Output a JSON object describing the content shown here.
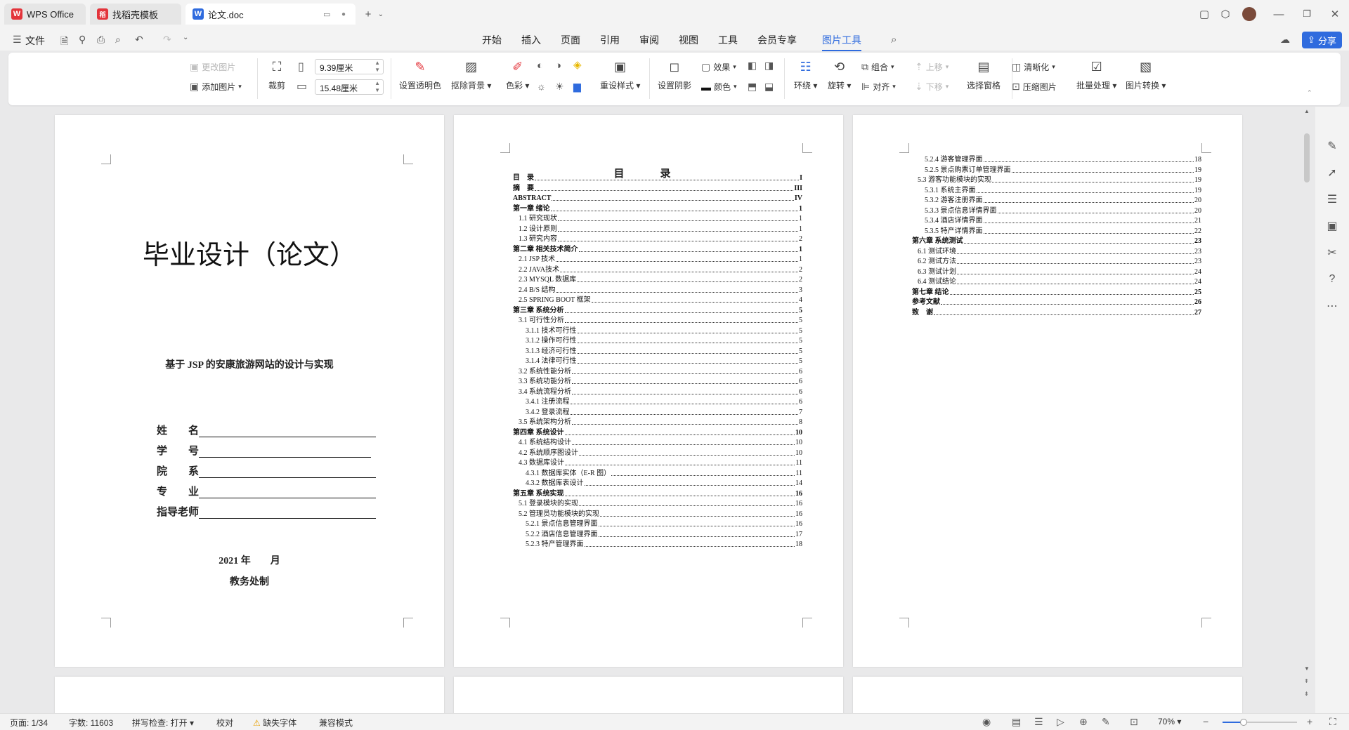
{
  "tabs": [
    {
      "label": "WPS Office",
      "logo": "W",
      "logo_color": "#e3343b"
    },
    {
      "label": "找稻壳模板",
      "logo": "稻",
      "logo_color": "#e3343b"
    },
    {
      "label": "论文.doc",
      "logo": "W",
      "logo_color": "#2f6bde"
    }
  ],
  "menu": {
    "file": "文件",
    "items": [
      "开始",
      "插入",
      "页面",
      "引用",
      "审阅",
      "视图",
      "工具",
      "会员专享",
      "图片工具"
    ],
    "active": "图片工具",
    "share": "分享"
  },
  "ribbon": {
    "change_image": "更改图片",
    "add_image": "添加图片",
    "crop": "裁剪",
    "width_value": "9.39厘米",
    "height_value": "15.48厘米",
    "set_transparent": "设置透明色",
    "remove_bg": "抠除背景",
    "color_shade": "色彩",
    "reset_style": "重设样式",
    "set_shadow": "设置阴影",
    "effect": "效果",
    "color": "颜色",
    "wrap": "环绕",
    "rotate": "旋转",
    "group": "组合",
    "align": "对齐",
    "move_up": "上移",
    "move_down": "下移",
    "selection_pane": "选择窗格",
    "sharpen": "清晰化",
    "compress": "压缩图片",
    "batch": "批量处理",
    "convert": "图片转换"
  },
  "page1": {
    "title": "毕业设计（论文）",
    "subtitle": "基于 JSP 的安康旅游网站的设计与实现",
    "fields": [
      "姓　　名",
      "学　　号",
      "院　　系",
      "专　　业",
      "指导老师"
    ],
    "date": "2021 年　　月",
    "office": "教务处制"
  },
  "toc_title": "目　录",
  "toc_page2": [
    {
      "t": "目　录",
      "n": "I",
      "lvl": 0,
      "b": true
    },
    {
      "t": "摘　要",
      "n": "III",
      "lvl": 0,
      "b": true
    },
    {
      "t": "ABSTRACT",
      "n": "IV",
      "lvl": 0,
      "b": true
    },
    {
      "t": "第一章  绪论",
      "n": "1",
      "lvl": 0,
      "b": true
    },
    {
      "t": "1.1 研究现状",
      "n": "1",
      "lvl": 1
    },
    {
      "t": "1.2 设计原则",
      "n": "1",
      "lvl": 1
    },
    {
      "t": "1.3 研究内容",
      "n": "2",
      "lvl": 1
    },
    {
      "t": "第二章  相关技术简介",
      "n": "1",
      "lvl": 0,
      "b": true
    },
    {
      "t": "2.1 JSP 技术",
      "n": "1",
      "lvl": 1
    },
    {
      "t": "2.2 JAVA技术",
      "n": "2",
      "lvl": 1
    },
    {
      "t": "2.3 MYSQL 数据库",
      "n": "2",
      "lvl": 1
    },
    {
      "t": "2.4 B/S 结构",
      "n": "3",
      "lvl": 1
    },
    {
      "t": "2.5 SPRING BOOT 框架",
      "n": "4",
      "lvl": 1
    },
    {
      "t": "第三章  系统分析",
      "n": "5",
      "lvl": 0,
      "b": true
    },
    {
      "t": "3.1 可行性分析",
      "n": "5",
      "lvl": 1
    },
    {
      "t": "3.1.1 技术可行性",
      "n": "5",
      "lvl": 2
    },
    {
      "t": "3.1.2  操作可行性",
      "n": "5",
      "lvl": 2
    },
    {
      "t": "3.1.3  经济可行性",
      "n": "5",
      "lvl": 2
    },
    {
      "t": "3.1.4  法律可行性",
      "n": "5",
      "lvl": 2
    },
    {
      "t": "3.2 系统性能分析",
      "n": "6",
      "lvl": 1
    },
    {
      "t": "3.3 系统功能分析",
      "n": "6",
      "lvl": 1
    },
    {
      "t": "3.4 系统流程分析",
      "n": "6",
      "lvl": 1
    },
    {
      "t": "3.4.1 注册流程",
      "n": "6",
      "lvl": 2
    },
    {
      "t": "3.4.2  登录流程",
      "n": "7",
      "lvl": 2
    },
    {
      "t": "3.5 系统架构分析",
      "n": "8",
      "lvl": 1
    },
    {
      "t": "第四章  系统设计",
      "n": "10",
      "lvl": 0,
      "b": true
    },
    {
      "t": "4.1 系统结构设计",
      "n": "10",
      "lvl": 1
    },
    {
      "t": "4.2 系统顺序图设计",
      "n": "10",
      "lvl": 1
    },
    {
      "t": "4.3 数据库设计",
      "n": "11",
      "lvl": 1
    },
    {
      "t": "4.3.1  数据库实体（E-R 图）",
      "n": "11",
      "lvl": 2
    },
    {
      "t": "4.3.2  数据库表设计",
      "n": "14",
      "lvl": 2
    },
    {
      "t": "第五章  系统实现",
      "n": "16",
      "lvl": 0,
      "b": true
    },
    {
      "t": "5.1 登录模块的实现",
      "n": "16",
      "lvl": 1
    },
    {
      "t": "5.2 管理员功能模块的实现",
      "n": "16",
      "lvl": 1
    },
    {
      "t": "5.2.1 景点信息管理界面",
      "n": "16",
      "lvl": 2
    },
    {
      "t": "5.2.2 酒店信息管理界面",
      "n": "17",
      "lvl": 2
    },
    {
      "t": "5.2.3 特产管理界面",
      "n": "18",
      "lvl": 2
    }
  ],
  "toc_page3": [
    {
      "t": "5.2.4 游客管理界面",
      "n": "18",
      "lvl": 2
    },
    {
      "t": "5.2.5 景点购票订单管理界面",
      "n": "19",
      "lvl": 2
    },
    {
      "t": "5.3 游客功能模块的实现",
      "n": "19",
      "lvl": 1
    },
    {
      "t": "5.3.1 系统主界面",
      "n": "19",
      "lvl": 2
    },
    {
      "t": "5.3.2 游客注册界面",
      "n": "20",
      "lvl": 2
    },
    {
      "t": "5.3.3 景点信息详情界面",
      "n": "20",
      "lvl": 2
    },
    {
      "t": "5.3.4 酒店详情界面",
      "n": "21",
      "lvl": 2
    },
    {
      "t": "5.3.5 特产详情界面",
      "n": "22",
      "lvl": 2
    },
    {
      "t": "第六章  系统测试",
      "n": "23",
      "lvl": 0,
      "b": true
    },
    {
      "t": "6.1 测试环境",
      "n": "23",
      "lvl": 1
    },
    {
      "t": "6.2 测试方法",
      "n": "23",
      "lvl": 1
    },
    {
      "t": "6.3 测试计划",
      "n": "24",
      "lvl": 1
    },
    {
      "t": "6.4 测试结论",
      "n": "24",
      "lvl": 1
    },
    {
      "t": "第七章  结论",
      "n": "25",
      "lvl": 0,
      "b": true
    },
    {
      "t": "参考文献",
      "n": "26",
      "lvl": 0,
      "b": true
    },
    {
      "t": "致　谢",
      "n": "27",
      "lvl": 0,
      "b": true
    }
  ],
  "status": {
    "page": "页面: 1/34",
    "words": "字数: 11603",
    "spell": "拼写检查: 打开",
    "proof": "校对",
    "missing_font": "缺失字体",
    "compat": "兼容模式",
    "zoom": "70%",
    "zoom_fraction": 0.28
  },
  "colors": {
    "accent": "#2f6bde",
    "wps_red": "#e3343b"
  }
}
